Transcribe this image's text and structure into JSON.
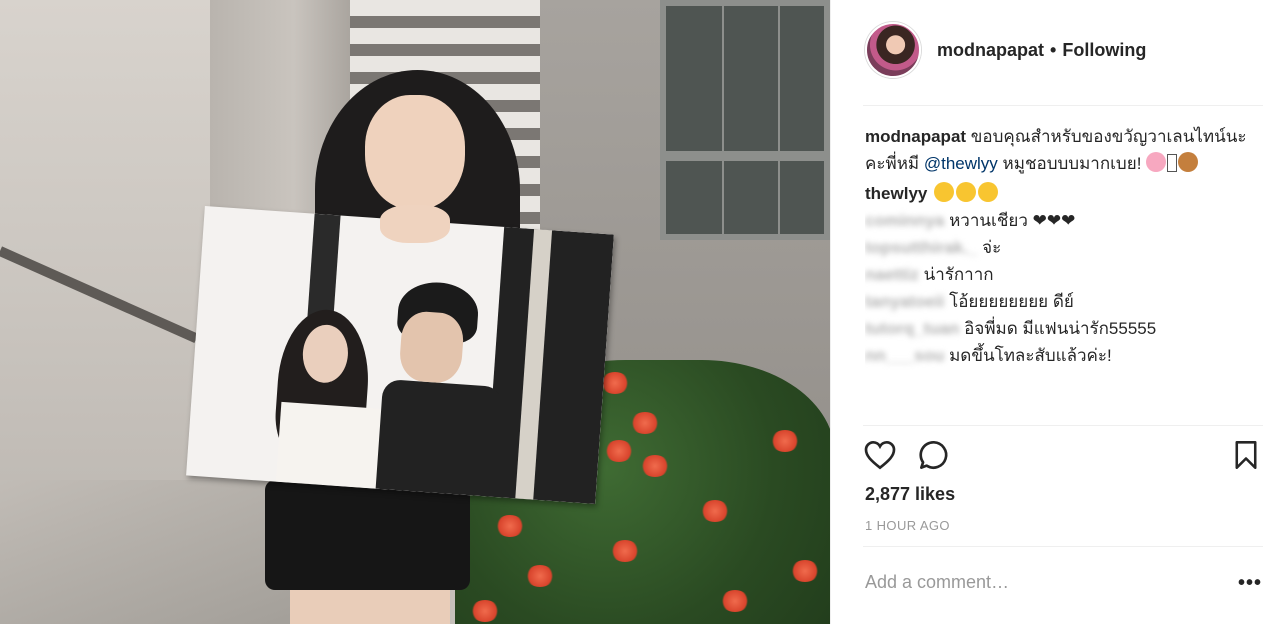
{
  "post": {
    "username": "modnapapat",
    "separator": "•",
    "follow_status": "Following"
  },
  "caption": {
    "username": "modnapapat",
    "text_before_mention": "ขอบคุณสำหรับของขวัญวาเลนไทน์นะคะพี่หมี",
    "mention": "@thewlyy",
    "text_after_mention": "หมูชอบบบมากเบย!"
  },
  "comments": [
    {
      "username": "thewlyy",
      "text": "",
      "emoji": [
        "smile",
        "smile",
        "grin"
      ]
    },
    {
      "username": "cominnya",
      "text": "หวานเชียว ❤❤❤",
      "blurred": true
    },
    {
      "username": "topsutthirak._",
      "text": "จ่ะ",
      "blurred": true
    },
    {
      "username": "naettiz",
      "text": "น่ารักาาก",
      "blurred": true
    },
    {
      "username": "tanyatoeii",
      "text": "โอ้ยยยยยยยย ดีย์",
      "blurred": true
    },
    {
      "username": "tutorq_tuan",
      "text": "อิจพี่มด มีแฟนน่ารัก55555",
      "blurred": true
    },
    {
      "username": "nn___sou",
      "text": "มดขึ้นโทละสับแล้วค่ะ!",
      "blurred": true
    }
  ],
  "icons": {
    "like": "heart-icon",
    "comment": "comment-icon",
    "save": "bookmark-icon"
  },
  "likes": "2,877 likes",
  "time": "1 HOUR AGO",
  "add_comment_placeholder": "Add a comment…",
  "more_label": "•••",
  "colors": {
    "mention": "#003569",
    "text": "#262626",
    "muted": "#999999"
  }
}
